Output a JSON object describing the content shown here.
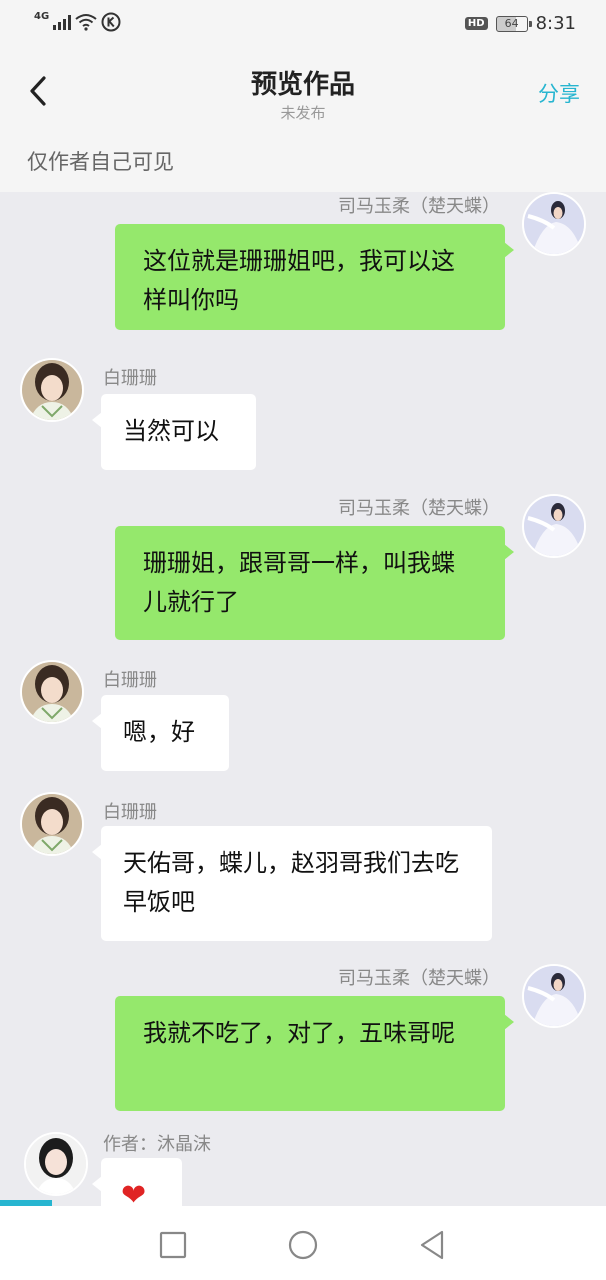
{
  "status_bar": {
    "network": "4G",
    "hd_badge": "HD",
    "battery": "64",
    "time": "8:31",
    "icons": [
      "signal-icon",
      "wifi-icon",
      "k-icon"
    ]
  },
  "header": {
    "title": "预览作品",
    "subtitle": "未发布",
    "share_label": "分享",
    "back_icon": "chevron-left-icon"
  },
  "notice": "仅作者自己可见",
  "messages": [
    {
      "side": "right",
      "name": "司马玉柔（楚天蝶）",
      "text": "这位就是珊珊姐吧，我可以这样叫你吗"
    },
    {
      "side": "left",
      "name": "白珊珊",
      "text": "当然可以"
    },
    {
      "side": "right",
      "name": "司马玉柔（楚天蝶）",
      "text": "珊珊姐，跟哥哥一样，叫我蝶儿就行了"
    },
    {
      "side": "left",
      "name": "白珊珊",
      "text": "嗯，好"
    },
    {
      "side": "left",
      "name": "白珊珊",
      "text": "天佑哥，蝶儿，赵羽哥我们去吃早饭吧"
    },
    {
      "side": "right",
      "name": "司马玉柔（楚天蝶）",
      "text": "我就不吃了，对了，五味哥呢"
    },
    {
      "side": "left",
      "name": "作者：沐晶沫",
      "text": "❤"
    }
  ],
  "nav": {
    "icons": [
      "square-recent-apps-icon",
      "circle-home-icon",
      "triangle-back-icon"
    ]
  },
  "colors": {
    "accent": "#27b5d0",
    "bubble_right": "#95e86c",
    "bubble_left": "#ffffff",
    "background": "#ebebef"
  }
}
